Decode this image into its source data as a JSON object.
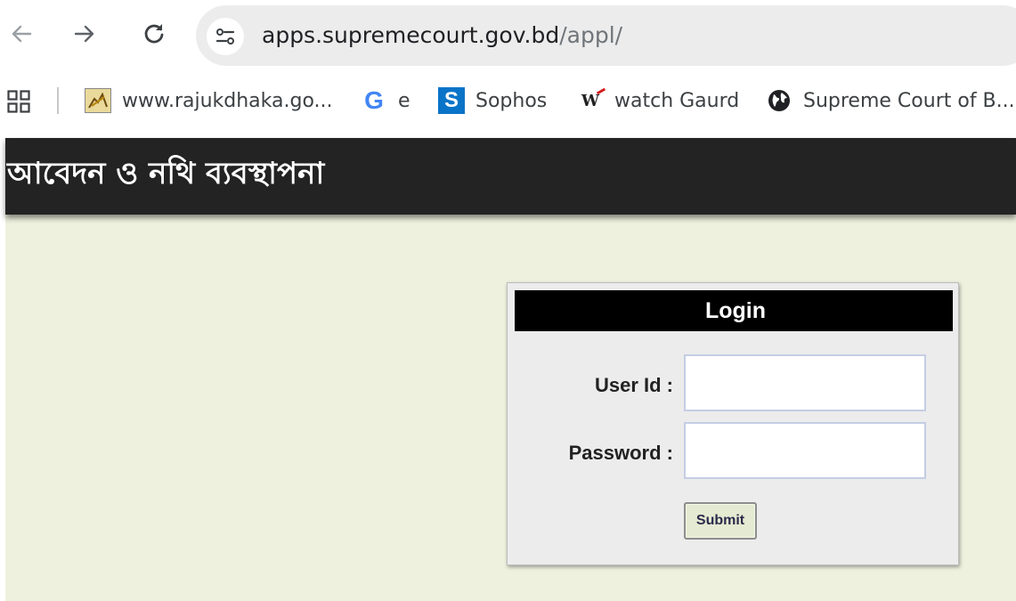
{
  "browser": {
    "nav": {
      "back_icon": "arrow-left-icon",
      "forward_icon": "arrow-right-icon",
      "reload_icon": "reload-icon"
    },
    "address_bar": {
      "site_info_icon": "tune-icon",
      "host": "apps.supremecourt.gov.bd",
      "path": "/appl/"
    },
    "bookmarks": {
      "apps_icon": "apps-grid-icon",
      "items": [
        {
          "label": "www.rajukdhaka.go...",
          "icon": "rajuk-favicon"
        },
        {
          "label": "e",
          "icon": "google-icon"
        },
        {
          "label": "Sophos",
          "icon": "sophos-icon"
        },
        {
          "label": "watch Gaurd",
          "icon": "watchguard-icon"
        },
        {
          "label": "Supreme Court of B...",
          "icon": "globe-icon"
        }
      ]
    }
  },
  "page": {
    "header_title": "আবেদন ও নথি ব্যবস্থাপনা",
    "colors": {
      "background": "#eef1de",
      "header_bg": "#232323",
      "panel_bg": "#ececec",
      "panel_head_bg": "#000000",
      "button_bg": "#e4ebd2"
    },
    "login": {
      "title": "Login",
      "user_label": "User Id :",
      "user_value": "",
      "password_label": "Password :",
      "password_value": "",
      "submit_label": "Submit"
    }
  }
}
